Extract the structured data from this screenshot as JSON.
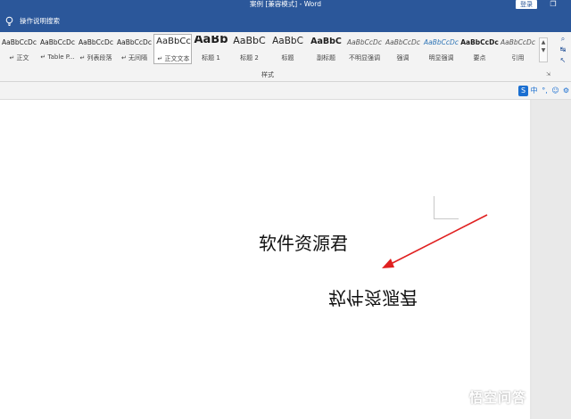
{
  "titlebar": {
    "title": "案例 [兼容模式]  -  Word",
    "login": "登录",
    "window_icon": "restore-icon"
  },
  "tellme": {
    "text": "操作说明搜索",
    "icon": "lightbulb-icon"
  },
  "ribbon": {
    "group_label": "样式",
    "styles": [
      {
        "sample": "AaBbCcDc",
        "label": "↵ 正文"
      },
      {
        "sample": "AaBbCcDc",
        "label": "↵ Table P..."
      },
      {
        "sample": "AaBbCcDc",
        "label": "↵ 列表段落"
      },
      {
        "sample": "AaBbCcDc",
        "label": "↵ 无间隔"
      },
      {
        "sample": "AaBbCc",
        "label": "↵ 正文文本"
      },
      {
        "sample": "AaBb",
        "label": "标题 1"
      },
      {
        "sample": "AaBbC",
        "label": "标题 2"
      },
      {
        "sample": "AaBbC",
        "label": "标题"
      },
      {
        "sample": "AaBbC",
        "label": "副标题"
      },
      {
        "sample": "AaBbCcDc",
        "label": "不明显强调"
      },
      {
        "sample": "AaBbCcDc",
        "label": "强调"
      },
      {
        "sample": "AaBbCcDc",
        "label": "明显强调"
      },
      {
        "sample": "AaBbCcDc",
        "label": "要点"
      },
      {
        "sample": "AaBbCcDc",
        "label": "引用"
      }
    ]
  },
  "ime": {
    "s_logo": "S",
    "lang": "中",
    "punct": "°,",
    "face": "☺",
    "settings": "⚙"
  },
  "document": {
    "text_normal": "软件资源君",
    "text_mirrored": "软件资源君",
    "arrow_color": "#e02020"
  },
  "watermark": {
    "logo": "悟",
    "text": "悟空问答"
  },
  "colors": {
    "word_blue": "#2b579a"
  }
}
